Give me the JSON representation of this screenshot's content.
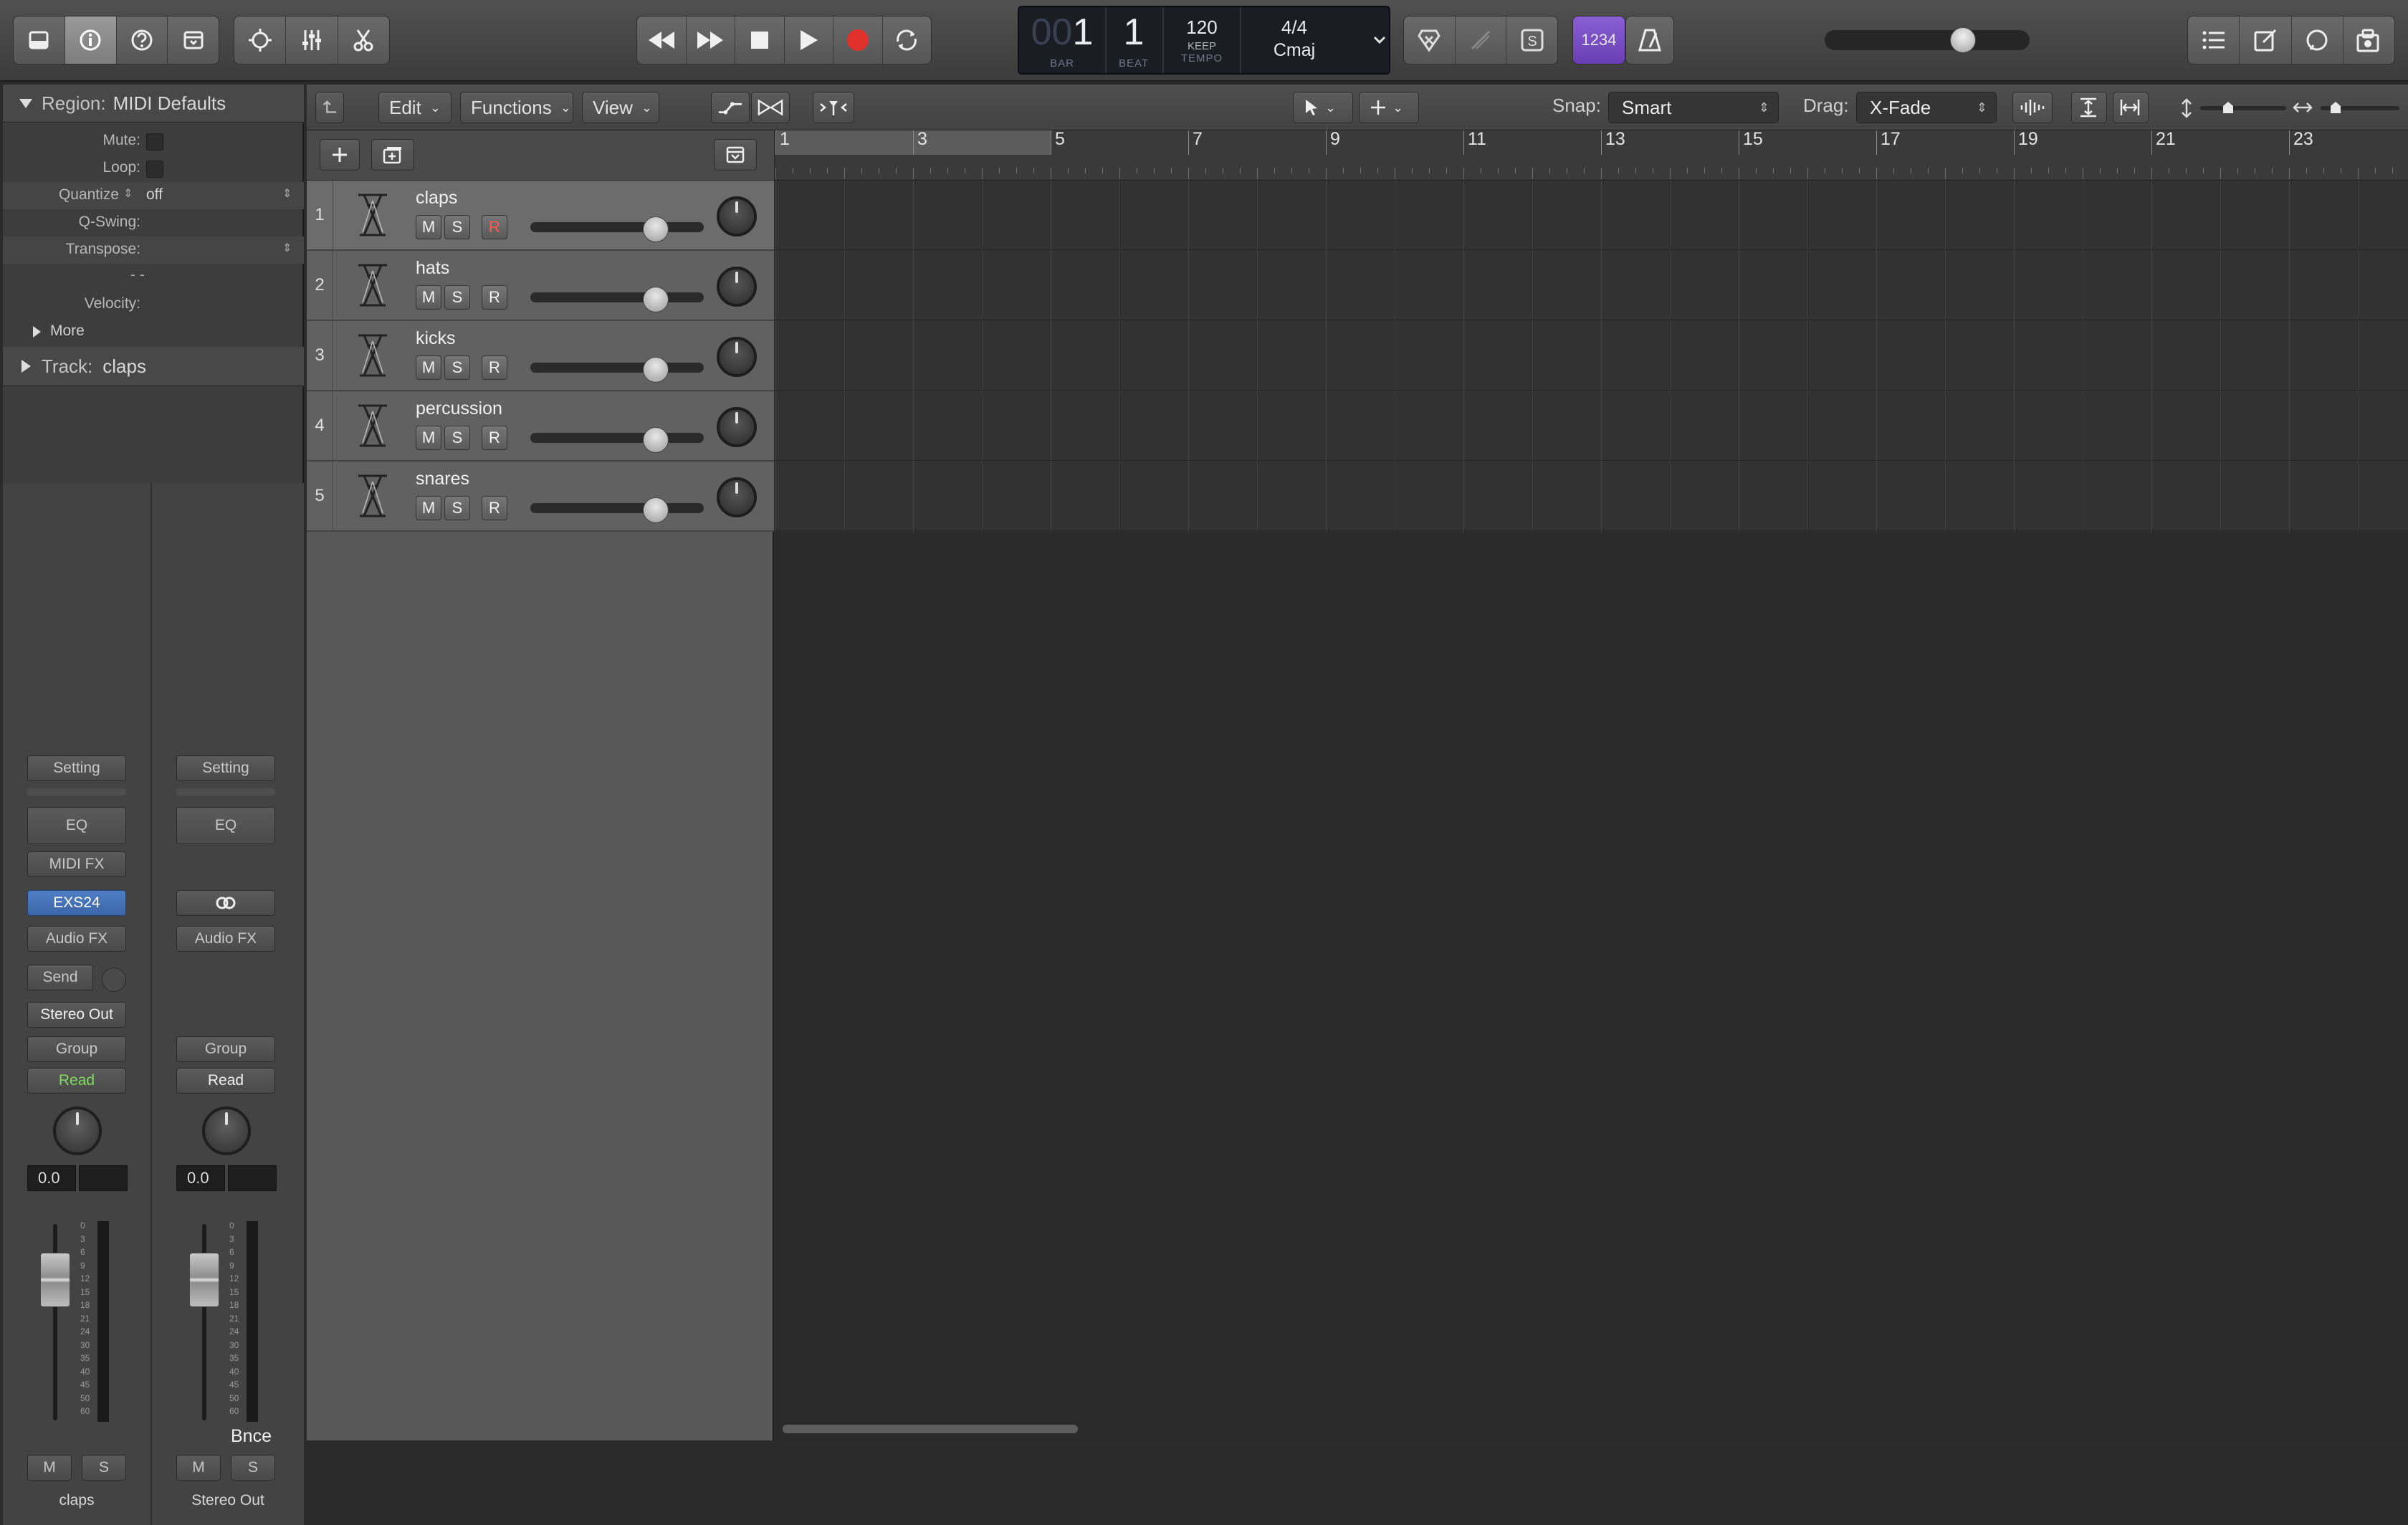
{
  "transport": {
    "bar": "1",
    "bar_prefix": "00",
    "beat": "1",
    "bar_caption": "BAR",
    "beat_caption": "BEAT",
    "tempo": "120",
    "tempo_keep": "KEEP",
    "tempo_caption": "TEMPO",
    "signature": "4/4",
    "key": "Cmaj",
    "count_in_label": "1234"
  },
  "colors": {
    "accent_purple": "#7a4fc4",
    "record_red": "#e0322b",
    "read_green": "#7fdc5c",
    "instrument_blue": "#4f7ec6"
  },
  "inspector": {
    "region_label": "Region:",
    "region_name": "MIDI Defaults",
    "rows": {
      "mute": "Mute:",
      "loop": "Loop:",
      "quantize": "Quantize",
      "quantize_value": "off",
      "qswing": "Q-Swing:",
      "transpose": "Transpose:",
      "dashes": "- -",
      "velocity": "Velocity:",
      "more": "More"
    },
    "track_label": "Track:",
    "track_name": "claps"
  },
  "strips": [
    {
      "name": "claps",
      "setting": "Setting",
      "eq": "EQ",
      "midi_fx": "MIDI FX",
      "instrument": "EXS24",
      "audio_fx": "Audio FX",
      "send": "Send",
      "output": "Stereo Out",
      "group": "Group",
      "automation": "Read",
      "volume": "0.0",
      "mute": "M",
      "solo": "S"
    },
    {
      "name": "Stereo Out",
      "setting": "Setting",
      "eq": "EQ",
      "link_icon": "link-icon",
      "audio_fx": "Audio FX",
      "group": "Group",
      "automation": "Read",
      "volume": "0.0",
      "bounce": "Bnce",
      "mute": "M",
      "solo": "S"
    }
  ],
  "fader_scale": [
    "0",
    "3",
    "6",
    "9",
    "12",
    "15",
    "18",
    "21",
    "24",
    "30",
    "35",
    "40",
    "45",
    "50",
    "60"
  ],
  "local_bar": {
    "edit": "Edit",
    "functions": "Functions",
    "view": "View",
    "snap_label": "Snap:",
    "snap_value": "Smart",
    "drag_label": "Drag:",
    "drag_value": "X-Fade"
  },
  "tracks": [
    {
      "number": "1",
      "name": "claps",
      "volume": 0.72,
      "mute": "M",
      "solo": "S",
      "record": "R",
      "record_armed": true,
      "selected": true
    },
    {
      "number": "2",
      "name": "hats",
      "volume": 0.72,
      "mute": "M",
      "solo": "S",
      "record": "R",
      "record_armed": false,
      "selected": false
    },
    {
      "number": "3",
      "name": "kicks",
      "volume": 0.72,
      "mute": "M",
      "solo": "S",
      "record": "R",
      "record_armed": false,
      "selected": false
    },
    {
      "number": "4",
      "name": "percussion",
      "volume": 0.72,
      "mute": "M",
      "solo": "S",
      "record": "R",
      "record_armed": false,
      "selected": false
    },
    {
      "number": "5",
      "name": "snares",
      "volume": 0.72,
      "mute": "M",
      "solo": "S",
      "record": "R",
      "record_armed": false,
      "selected": false
    }
  ],
  "ruler": {
    "bars": [
      "1",
      "3",
      "5",
      "7",
      "9",
      "11",
      "13",
      "15",
      "17",
      "19",
      "21",
      "23"
    ],
    "cycle_end_bar": 5
  },
  "master_volume": 0.7
}
